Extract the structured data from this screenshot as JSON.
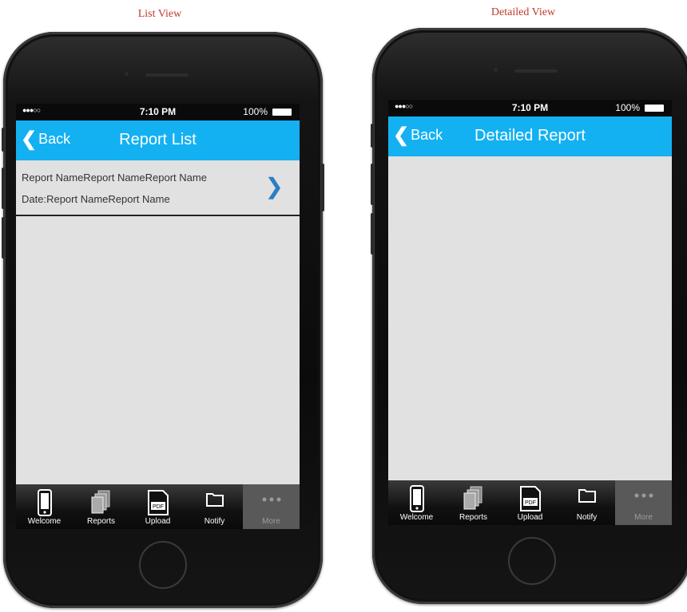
{
  "captions": {
    "left": "List View",
    "right": "Detailed View"
  },
  "status": {
    "signal": "●●●○○",
    "time": "7:10 PM",
    "battery": "100%"
  },
  "list_view": {
    "back_label": "Back",
    "title": "Report List",
    "items": [
      {
        "line1": "Report NameReport NameReport Name",
        "line2": "Date:Report NameReport Name"
      }
    ]
  },
  "detail_view": {
    "back_label": "Back",
    "title": "Detailed Report"
  },
  "tabs": [
    {
      "label": "Welcome",
      "icon": "phone-icon"
    },
    {
      "label": "Reports",
      "icon": "reports-icon"
    },
    {
      "label": "Upload",
      "icon": "pdf-icon"
    },
    {
      "label": "Notify",
      "icon": "folder-icon"
    },
    {
      "label": "More",
      "icon": "more-icon"
    }
  ],
  "colors": {
    "navbar": "#13b1f2",
    "caption": "#c0392b",
    "screen_bg": "#e1e1e1"
  }
}
